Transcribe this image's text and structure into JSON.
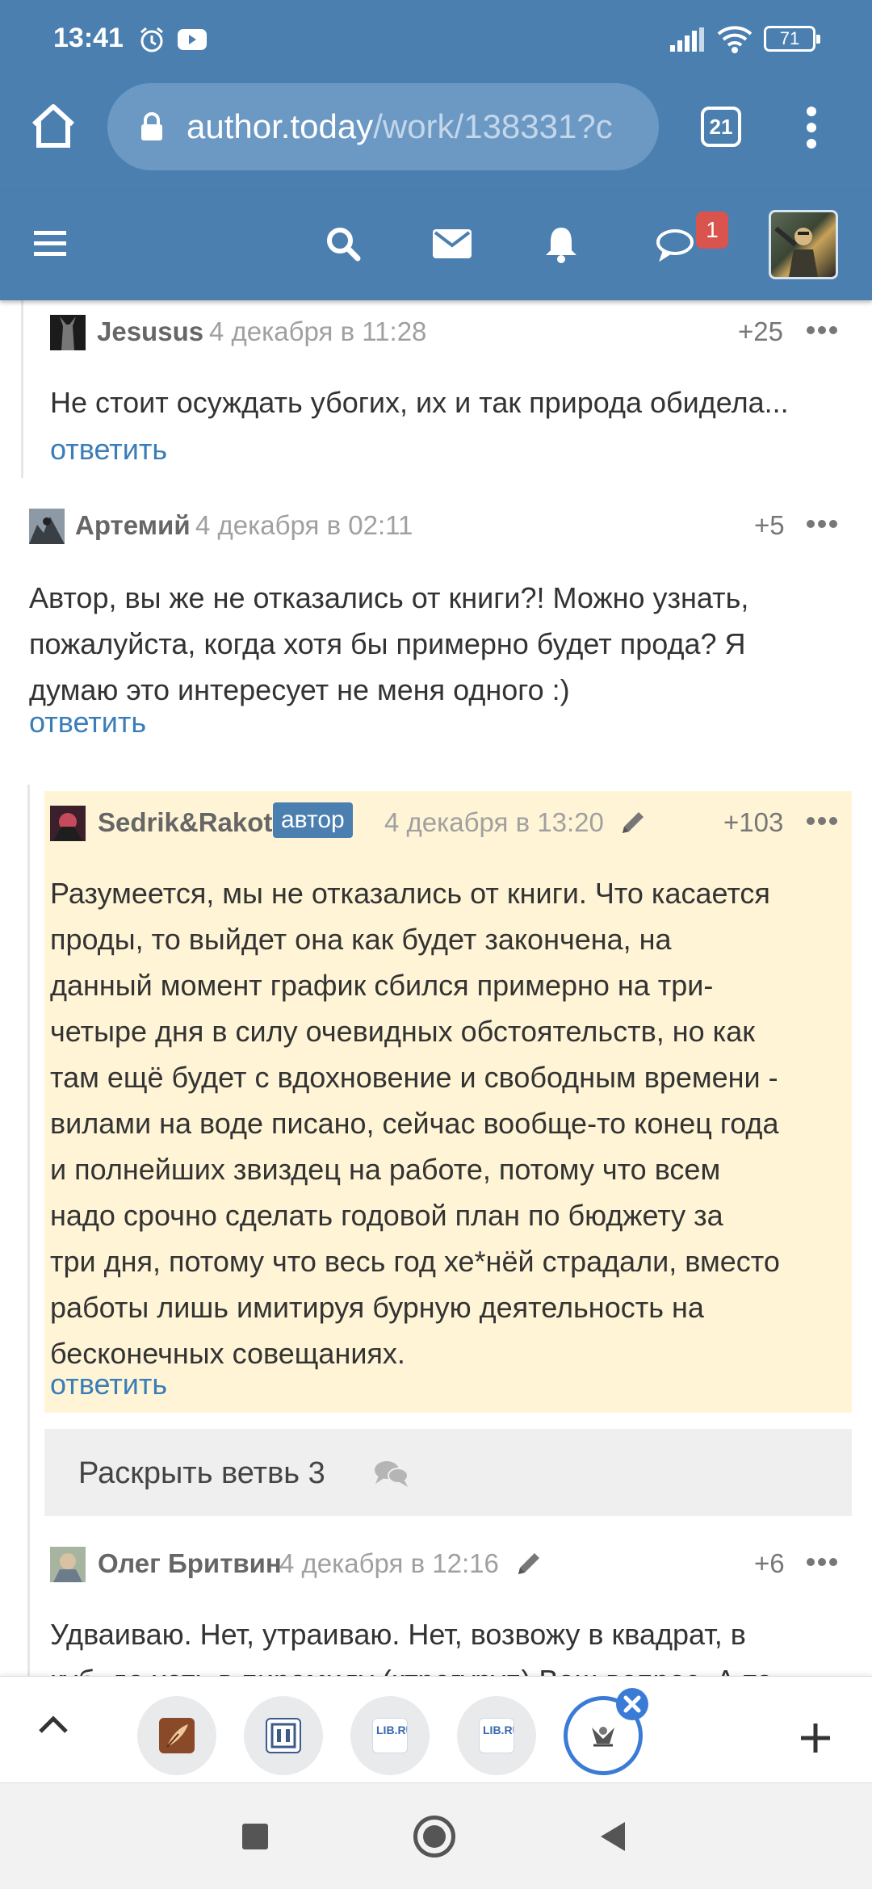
{
  "status_bar": {
    "time": "13:41",
    "battery": "71",
    "icons": [
      "alarm-icon",
      "youtube-icon",
      "signal-icon",
      "wifi-icon",
      "battery-icon"
    ]
  },
  "browser": {
    "url_host": "author.today",
    "url_path": "/work/138331?c",
    "tab_count": "21",
    "icons": [
      "home-icon",
      "lock-icon",
      "more-vert-icon"
    ]
  },
  "site_nav": {
    "chat_badge": "1",
    "icons": [
      "hamburger-icon",
      "search-icon",
      "mail-icon",
      "bell-icon",
      "chat-icon"
    ],
    "colors": {
      "nav_bg": "#4a7fb0",
      "badge": "#d9534f"
    }
  },
  "comments": [
    {
      "author": "Jesusus",
      "date": "4 декабря в 11:28",
      "rating": "+25",
      "text": "Не стоит осуждать убогих, их и так природа обидела...",
      "reply": "ответить"
    },
    {
      "author": "Артемий",
      "date": "4 декабря в 02:11",
      "rating": "+5",
      "text_lines": [
        "Автор, вы же не отказались от книги?! Можно узнать,",
        "пожалуйста, когда хотя бы примерно будет прода? Я",
        "думаю это интересует не меня одного :)"
      ],
      "reply": "ответить"
    },
    {
      "author": "Sedrik&Rakot",
      "badge": "автор",
      "date": "4 декабря в 13:20",
      "rating": "+103",
      "text_lines": [
        "Разумеется, мы не отказались от книги. Что касается",
        "проды, то выйдет она как будет закончена, на",
        "данный момент график сбился примерно на три-",
        "четыре дня в силу очевидных обстоятельств, но как",
        "там ещё будет с вдохновение и свободным времени -",
        "вилами на воде писано, сейчас вообще-то конец года",
        "и полнейших звиздец на работе, потому что всем",
        "надо срочно сделать годовой план по бюджету за",
        "три дня, потому что весь год хе*нёй страдали, вместо",
        "работы лишь имитируя бурную деятельность на",
        "бесконечных совещаниях."
      ],
      "reply": "ответить",
      "highlight_color": "#fff5d6"
    },
    {
      "author": "Олег Бритвин",
      "date": "4 декабря в 12:16",
      "rating": "+6",
      "text_lines": [
        "Удваиваю. Нет, утраиваю. Нет, возвожу в квадрат, в",
        "куб, да хоть в пирамиду (ктрегуруп) Ваш вопрос. А то"
      ]
    }
  ],
  "branch": {
    "label": "Раскрыть ветвь 3"
  },
  "tab_strip": {
    "tabs": [
      {
        "label": "LIB.RU"
      },
      {
        "label": "LIB.RU"
      }
    ],
    "icons": [
      "chevron-up-icon",
      "quill-favicon",
      "library-favicon",
      "librus-favicon",
      "author-today-favicon",
      "close-icon",
      "plus-icon"
    ]
  },
  "android_nav": {
    "icons": [
      "recent-apps-icon",
      "home-circle-icon",
      "back-icon"
    ]
  }
}
